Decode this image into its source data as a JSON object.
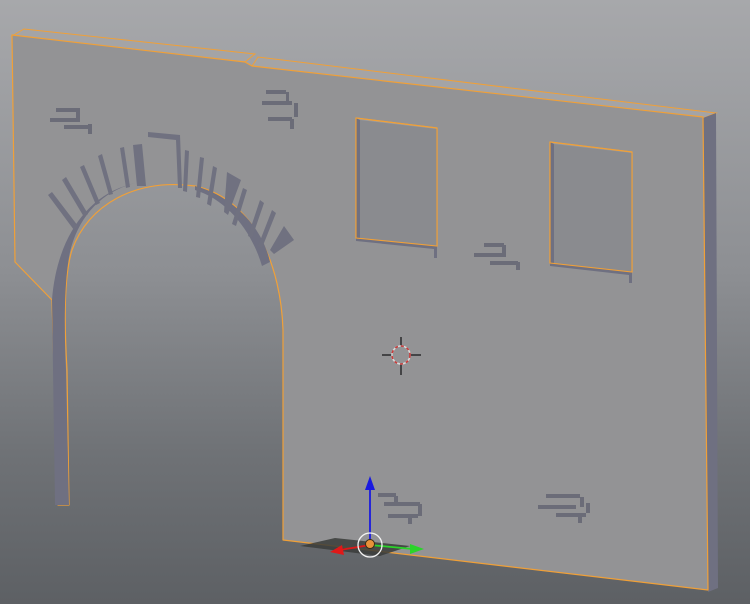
{
  "viewport": {
    "view": "3d-viewport",
    "background_top": "#a7a8ab",
    "background_bottom": "#5d6064"
  },
  "object": {
    "type": "wall-mesh",
    "selected": true,
    "face_color": "#939395",
    "side_color": "#6f7081",
    "top_color": "#a4a4a6",
    "outline_color": "#f0a038",
    "features": [
      "arched-doorway",
      "arch-voussoirs",
      "window-left",
      "window-right",
      "brick-details"
    ]
  },
  "cursor_3d": {
    "ring_color_a": "#d8d8d8",
    "ring_color_b": "#c83c3c",
    "crosshair_color": "#111111"
  },
  "gizmo": {
    "x_axis_color": "#e01818",
    "y_axis_color": "#2ad42a",
    "z_axis_color": "#1a1ae0",
    "origin_color": "#e8913a"
  }
}
